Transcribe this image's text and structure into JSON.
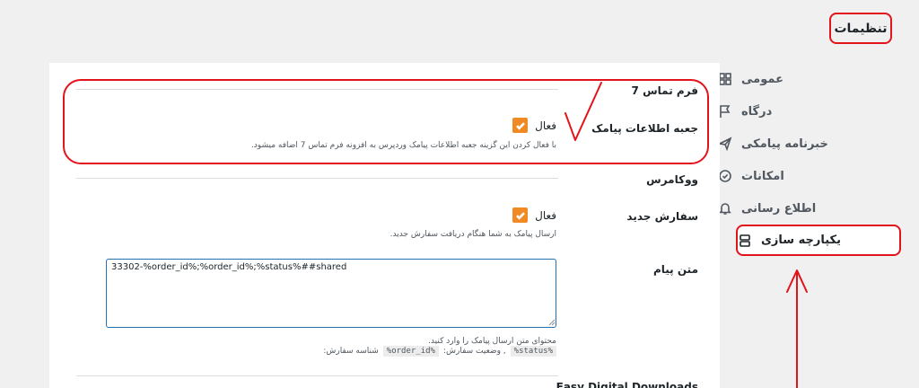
{
  "page_title": "تنظیمات",
  "sidebar": {
    "items": [
      {
        "label": "عمومی",
        "icon": "grid-icon"
      },
      {
        "label": "درگاه",
        "icon": "flag-icon"
      },
      {
        "label": "خبرنامه پیامکی",
        "icon": "send-icon"
      },
      {
        "label": "امکانات",
        "icon": "check-circle-icon"
      },
      {
        "label": "اطلاع رسانی",
        "icon": "bell-icon"
      },
      {
        "label": "یکپارچه سازی",
        "icon": "integration-icon",
        "active": true
      }
    ]
  },
  "cf7": {
    "section_title": "فرم تماس 7",
    "row_label": "جعبه اطلاعات پیامک",
    "checkbox_label": "فعال",
    "checked": true,
    "description": "با فعال کردن این گزینه جعبه اطلاعات پیامک وردپرس به افزونه فرم تماس 7 اضافه میشود."
  },
  "woocommerce": {
    "section_title": "ووکامرس",
    "new_order_label": "سفارش جدید",
    "checkbox_label": "فعال",
    "checked": true,
    "description": "ارسال پیامک به شما هنگام دریافت سفارش جدید.",
    "message_label": "متن پیام",
    "message_value": "33302-%order_id%;%order_id%;%status%##shared",
    "message_help": "محتوای متن ارسال پیامک را وارد کنید.",
    "tags_prefix": "شناسه سفارش:",
    "tag_order_id": "%order_id%",
    "tags_sep": ", وضعیت سفارش:",
    "tag_status": "%status%"
  },
  "edd": {
    "section_title": "Easy Digital Downloads"
  },
  "colors": {
    "accent": "#f08a24",
    "annotation": "#e3131b",
    "focus": "#2271b1"
  }
}
